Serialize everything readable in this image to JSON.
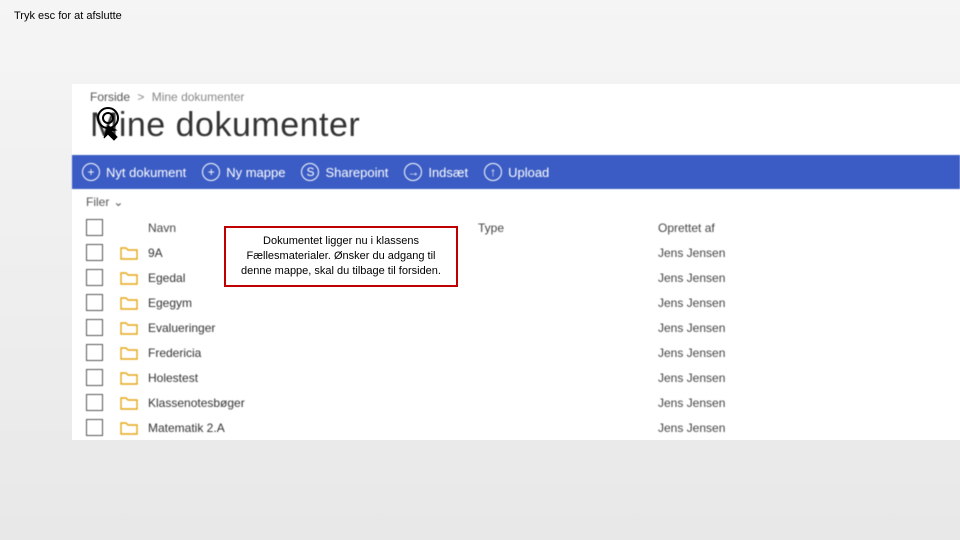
{
  "esc_hint": "Tryk esc for at afslutte",
  "breadcrumb": {
    "home": "Forside",
    "sep": ">",
    "current": "Mine dokumenter"
  },
  "page_title": "Mine dokumenter",
  "actions": {
    "new_doc": "Nyt dokument",
    "new_folder": "Ny mappe",
    "sharepoint": "Sharepoint",
    "insert": "Indsæt",
    "upload": "Upload"
  },
  "filter_label": "Filer",
  "columns": {
    "name": "Navn",
    "type": "Type",
    "created": "Oprettet af"
  },
  "rows": [
    {
      "name": "9A",
      "type": "",
      "created": "Jens Jensen"
    },
    {
      "name": "Egedal",
      "type": "",
      "created": "Jens Jensen"
    },
    {
      "name": "Egegym",
      "type": "",
      "created": "Jens Jensen"
    },
    {
      "name": "Evalueringer",
      "type": "",
      "created": "Jens Jensen"
    },
    {
      "name": "Fredericia",
      "type": "",
      "created": "Jens Jensen"
    },
    {
      "name": "Holestest",
      "type": "",
      "created": "Jens Jensen"
    },
    {
      "name": "Klassenotesbøger",
      "type": "",
      "created": "Jens Jensen"
    },
    {
      "name": "Matematik 2.A",
      "type": "",
      "created": "Jens Jensen"
    }
  ],
  "callout_text": "Dokumentet ligger nu i klassens Fællesmaterialer. Ønsker du adgang til denne mappe, skal du tilbage til forsiden."
}
